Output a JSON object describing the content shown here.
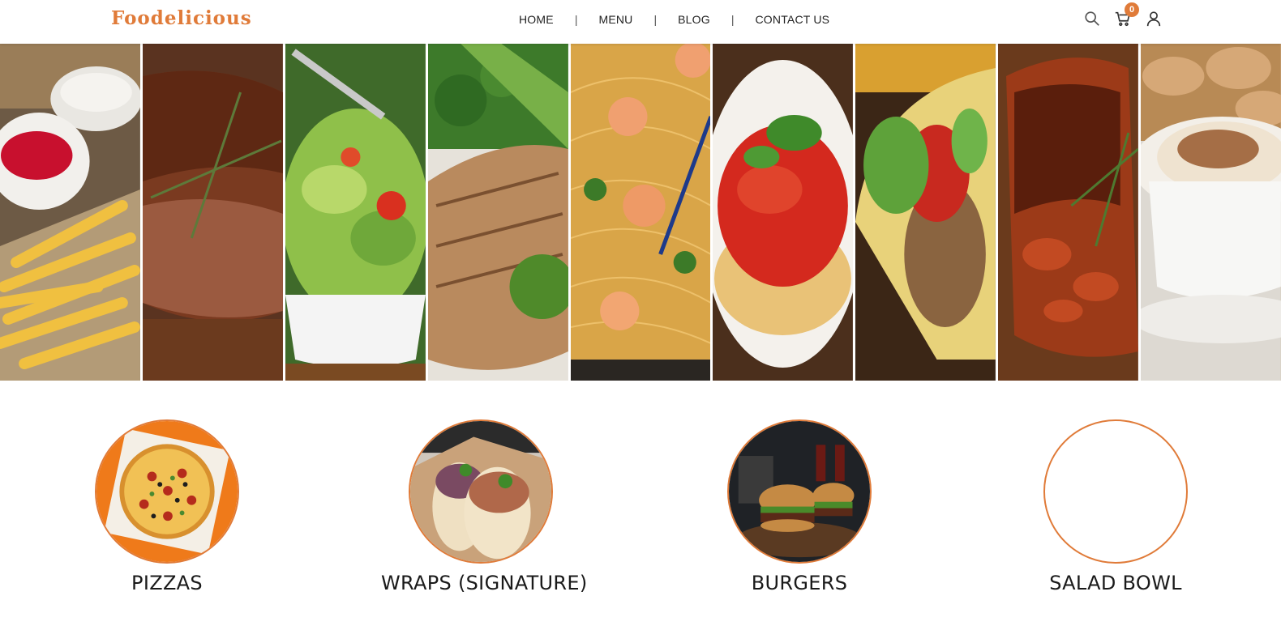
{
  "brand": {
    "name": "Foodelicious",
    "accent": "#e07b39"
  },
  "nav": {
    "items": [
      {
        "label": "HOME"
      },
      {
        "label": "MENU"
      },
      {
        "label": "BLOG"
      },
      {
        "label": "CONTACT US"
      }
    ],
    "separator": "|"
  },
  "header_icons": {
    "search": "search-icon",
    "cart": "cart-icon",
    "cart_count": "0",
    "account": "user-icon"
  },
  "hero": {
    "panels": [
      "fries",
      "steak",
      "salad",
      "grilled-fish",
      "shrimp-noodles",
      "spaghetti",
      "tacos",
      "grilled-chicken",
      "cappuccino"
    ]
  },
  "categories": [
    {
      "label": "PIZZAS",
      "image": "pizza"
    },
    {
      "label": "WRAPS (SIGNATURE)",
      "image": "wraps"
    },
    {
      "label": "BURGERS",
      "image": "burgers"
    },
    {
      "label": "SALAD BOWL",
      "image": "empty"
    }
  ]
}
